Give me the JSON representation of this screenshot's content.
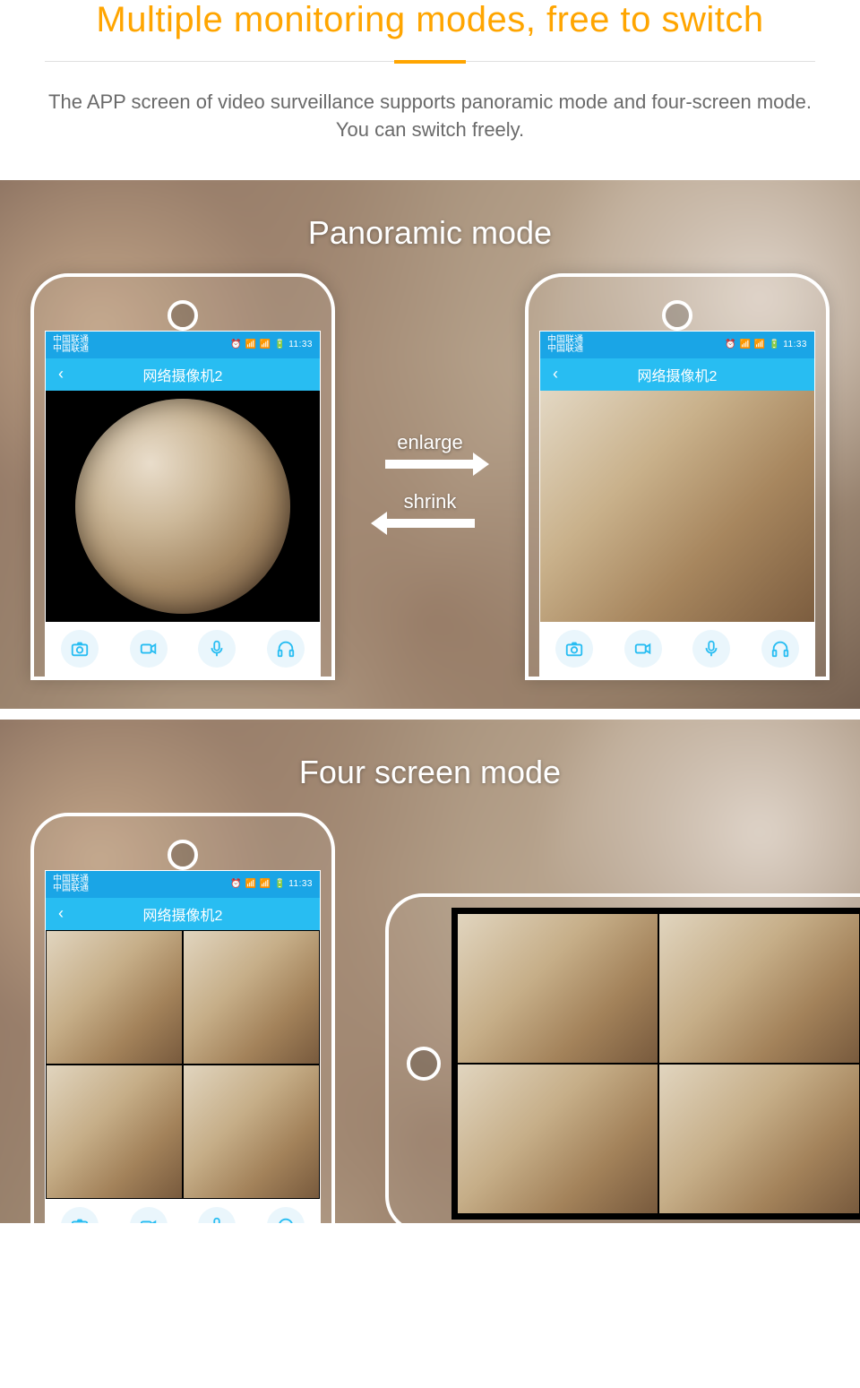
{
  "header": {
    "title": "Multiple monitoring modes, free to switch",
    "subtitle": "The APP screen of video surveillance supports panoramic mode and four-screen mode. You can switch freely."
  },
  "section1": {
    "label": "Panoramic mode",
    "enlarge_label": "enlarge",
    "shrink_label": "shrink"
  },
  "section2": {
    "label": "Four screen mode"
  },
  "app": {
    "carrier_line1": "中国联通",
    "carrier_line2": "中国联通",
    "status_right": "⏰ 📶 📶 🔋 11:33",
    "time": "11:33",
    "title": "网络摄像机2",
    "back_glyph": "‹"
  },
  "toolbar": {
    "camera": "camera-icon",
    "video": "video-icon",
    "mic": "mic-icon",
    "headphones": "headphones-icon"
  },
  "colors": {
    "accent_orange": "#ffa500",
    "app_primary": "#28bdf2",
    "status_primary": "#1aa5e6",
    "tb_bg": "#eaf6fc"
  }
}
